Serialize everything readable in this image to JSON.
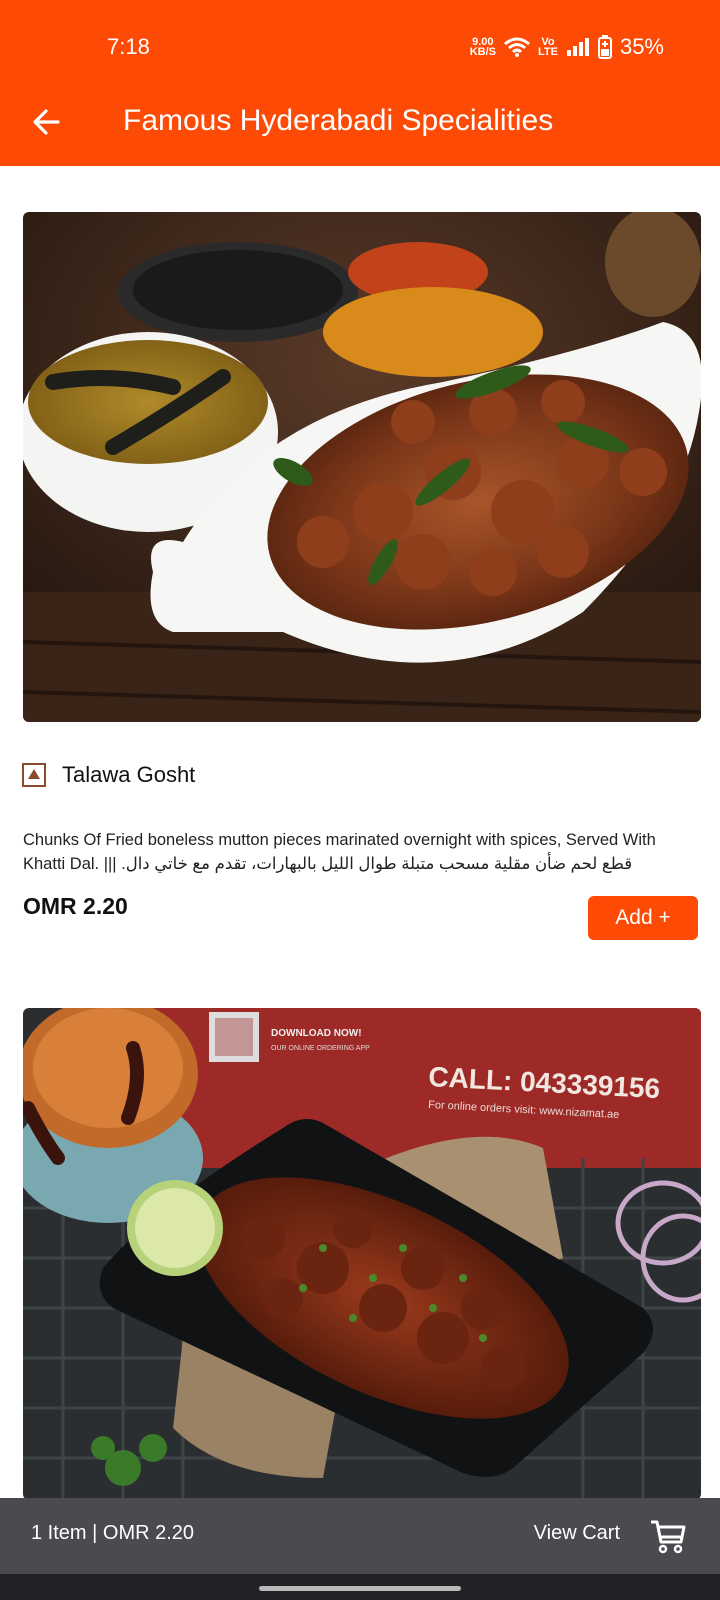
{
  "status": {
    "time": "7:18",
    "net_speed_value": "9.00",
    "net_speed_unit": "KB/S",
    "network_label_top": "Vo",
    "network_label_bottom": "LTE",
    "battery": "35%"
  },
  "header": {
    "title": "Famous Hyderabadi Specialities"
  },
  "items": [
    {
      "name": "Talawa Gosht",
      "description": "Chunks Of Fried boneless mutton pieces marinated overnight with spices, Served With Khatti Dal. ||| .قطع لحم ضأن مقلية مسحب متبلة طوال الليل بالبهارات، تقدم مع خاتي دال",
      "price": "OMR 2.20",
      "add_label": "Add +"
    }
  ],
  "second_image": {
    "box_text_download": "DOWNLOAD NOW!",
    "box_text_subtitle": "OUR ONLINE ORDERING APP",
    "box_text_call": "CALL: 043339156",
    "box_text_visit": "For online orders visit: www.nizamat.ae"
  },
  "cart": {
    "summary": "1 Item | OMR 2.20",
    "view_cart_label": "View Cart"
  },
  "colors": {
    "brand": "#fd4a05",
    "cart_bar": "#4a4a4f",
    "nonveg_marker": "#8a4a2e"
  }
}
